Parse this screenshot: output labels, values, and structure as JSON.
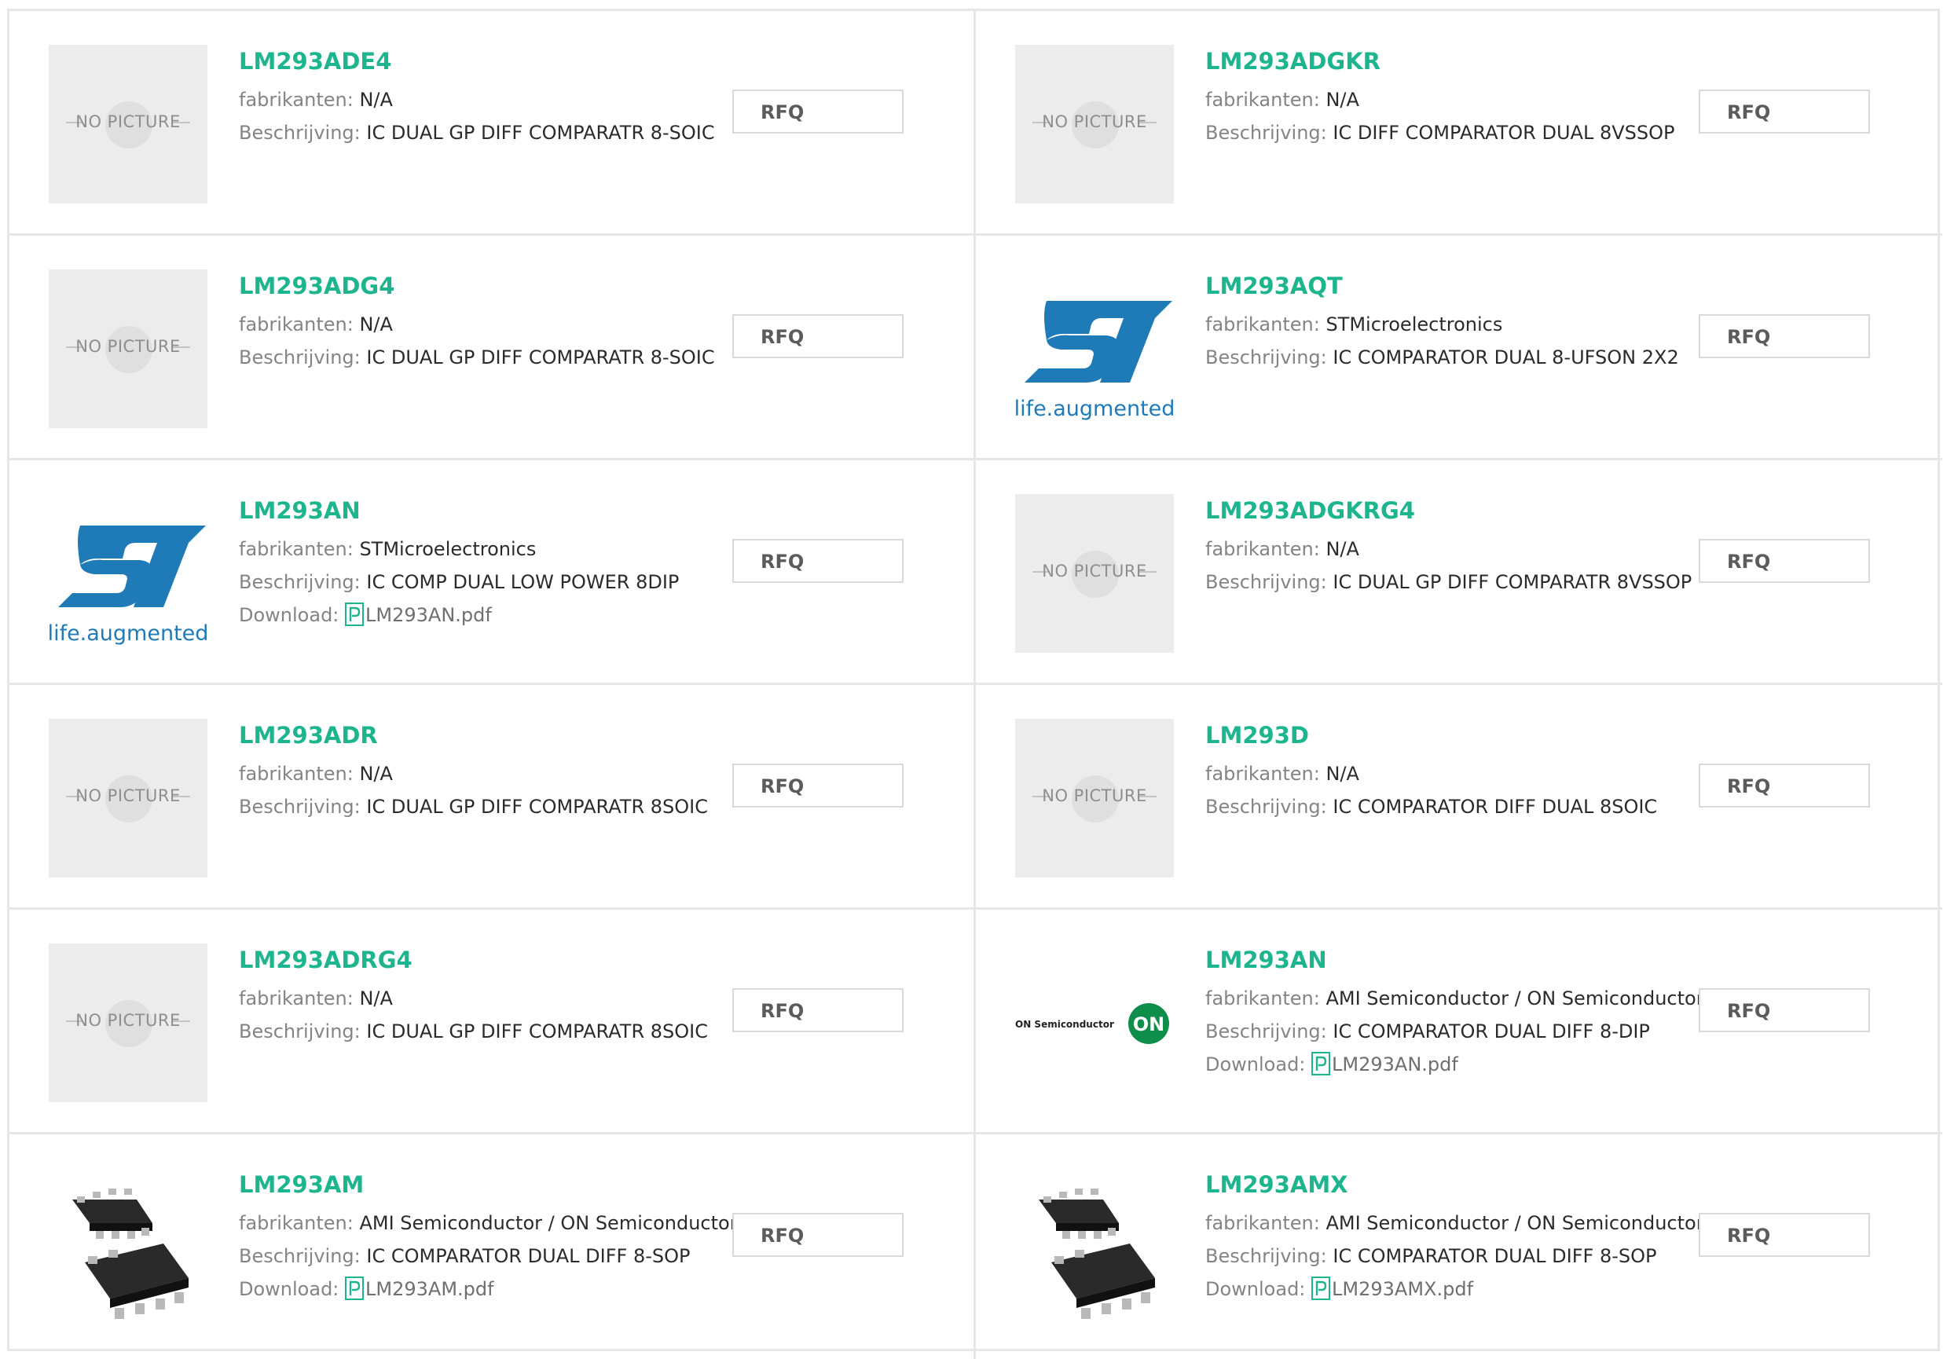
{
  "labels": {
    "manufacturer": "fabrikanten:",
    "description": "Beschrijving:",
    "download": "Download:",
    "rfq": "RFQ",
    "no_picture": "NO PICTURE",
    "st_tagline": "life.augmented",
    "on_text": "ON Semiconductor",
    "on_mark": "ON"
  },
  "colors": {
    "part_number": "#1db58e",
    "border": "#e6e6e6",
    "st_blue": "#1f7ab8",
    "on_green": "#0d8e4a"
  },
  "products": [
    {
      "part": "LM293ADE4",
      "manufacturer": "N/A",
      "description": "IC DUAL GP DIFF COMPARATR 8-SOIC",
      "download": null,
      "image": "no-picture"
    },
    {
      "part": "LM293ADGKR",
      "manufacturer": "N/A",
      "description": "IC DIFF COMPARATOR DUAL 8VSSOP",
      "download": null,
      "image": "no-picture"
    },
    {
      "part": "LM293ADG4",
      "manufacturer": "N/A",
      "description": "IC DUAL GP DIFF COMPARATR 8-SOIC",
      "download": null,
      "image": "no-picture"
    },
    {
      "part": "LM293AQT",
      "manufacturer": "STMicroelectronics",
      "description": "IC COMPARATOR DUAL 8-UFSON 2X2",
      "download": null,
      "image": "st-logo"
    },
    {
      "part": "LM293AN",
      "manufacturer": "STMicroelectronics",
      "description": "IC COMP DUAL LOW POWER 8DIP",
      "download": "LM293AN.pdf",
      "image": "st-logo"
    },
    {
      "part": "LM293ADGKRG4",
      "manufacturer": "N/A",
      "description": "IC DUAL GP DIFF COMPARATR 8VSSOP",
      "download": null,
      "image": "no-picture"
    },
    {
      "part": "LM293ADR",
      "manufacturer": "N/A",
      "description": "IC DUAL GP DIFF COMPARATR 8SOIC",
      "download": null,
      "image": "no-picture"
    },
    {
      "part": "LM293D",
      "manufacturer": "N/A",
      "description": "IC COMPARATOR DIFF DUAL 8SOIC",
      "download": null,
      "image": "no-picture"
    },
    {
      "part": "LM293ADRG4",
      "manufacturer": "N/A",
      "description": "IC DUAL GP DIFF COMPARATR 8SOIC",
      "download": null,
      "image": "no-picture"
    },
    {
      "part": "LM293AN",
      "manufacturer": "AMI Semiconductor / ON Semiconductor",
      "description": "IC COMPARATOR DUAL DIFF 8-DIP",
      "download": "LM293AN.pdf",
      "image": "on-logo"
    },
    {
      "part": "LM293AM",
      "manufacturer": "AMI Semiconductor / ON Semiconductor",
      "description": "IC COMPARATOR DUAL DIFF 8-SOP",
      "download": "LM293AM.pdf",
      "image": "ic-chip"
    },
    {
      "part": "LM293AMX",
      "manufacturer": "AMI Semiconductor / ON Semiconductor",
      "description": "IC COMPARATOR DUAL DIFF 8-SOP",
      "download": "LM293AMX.pdf",
      "image": "ic-chip"
    }
  ]
}
